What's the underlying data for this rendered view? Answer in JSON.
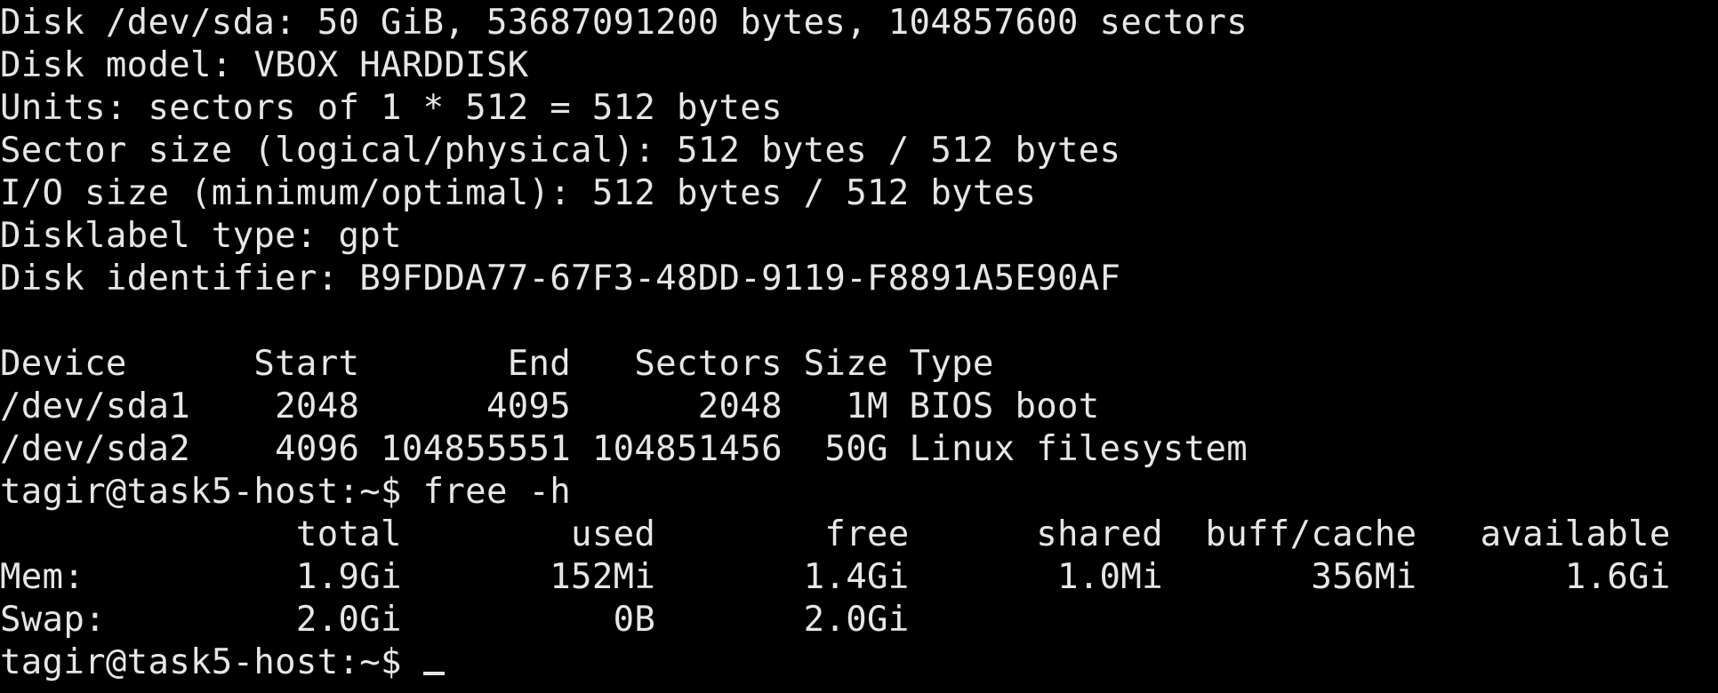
{
  "terminal": {
    "lines": [
      "Disk /dev/sda: 50 GiB, 53687091200 bytes, 104857600 sectors",
      "Disk model: VBOX HARDDISK",
      "Units: sectors of 1 * 512 = 512 bytes",
      "Sector size (logical/physical): 512 bytes / 512 bytes",
      "I/O size (minimum/optimal): 512 bytes / 512 bytes",
      "Disklabel type: gpt",
      "Disk identifier: B9FDDA77-67F3-48DD-9119-F8891A5E90AF",
      "",
      "Device      Start       End   Sectors Size Type",
      "/dev/sda1    2048      4095      2048   1M BIOS boot",
      "/dev/sda2    4096 104855551 104851456  50G Linux filesystem",
      "tagir@task5-host:~$ free -h",
      "              total        used        free      shared  buff/cache   available",
      "Mem:          1.9Gi       152Mi       1.4Gi       1.0Mi       356Mi       1.6Gi",
      "Swap:         2.0Gi          0B       2.0Gi"
    ],
    "prompt": "tagir@task5-host:~$ ",
    "colors": {
      "background": "#000000",
      "foreground": "#e6e6e6"
    }
  }
}
